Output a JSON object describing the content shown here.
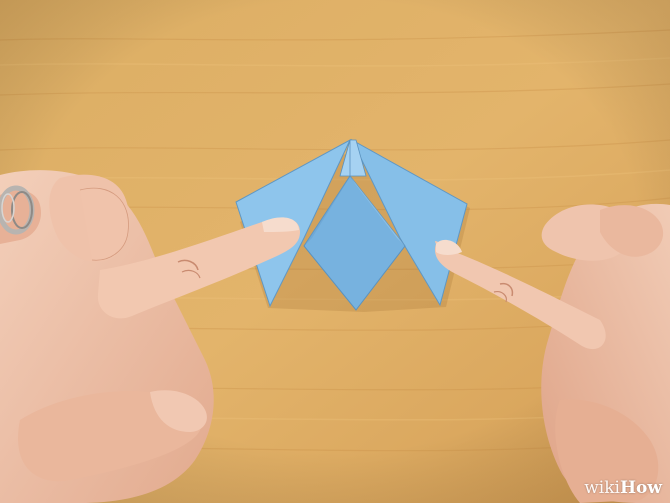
{
  "image": {
    "subject": "origami-fold-step",
    "colors": {
      "wood_light": "#e2b56a",
      "wood_mid": "#d6a35a",
      "wood_dark": "#c38e46",
      "paper_main": "#8cc4ec",
      "paper_shade": "#6fa9d6",
      "paper_light": "#a9d4f2",
      "paper_edge": "#5a92bf",
      "skin_light": "#f1c9b2",
      "skin_mid": "#e3ab90",
      "skin_shadow": "#c98b70",
      "ring": "#b9b6b2"
    }
  },
  "watermark": {
    "part1": "wiki",
    "part2": "How"
  }
}
